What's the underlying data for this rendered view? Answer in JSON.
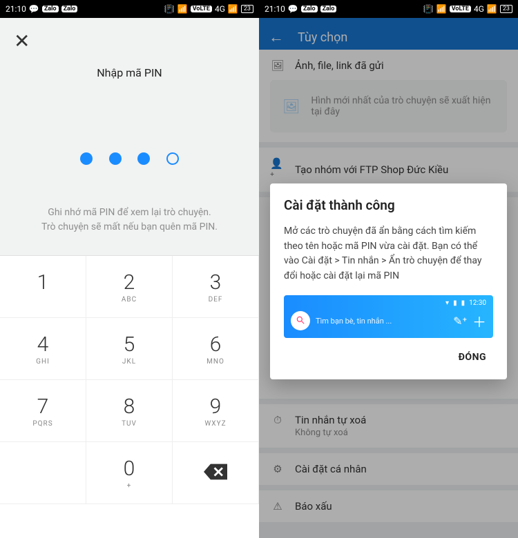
{
  "status": {
    "time": "21:10",
    "volte": "VoLTE",
    "lte": "4G",
    "battery": "23",
    "zalo": "Zalo"
  },
  "left": {
    "title": "Nhập mã PIN",
    "hint_line1": "Ghi nhớ mã PIN để xem lại trò chuyện.",
    "hint_line2": "Trò chuyện sẽ mất nếu bạn quên mã PIN.",
    "pin_entered": 3,
    "pin_total": 4,
    "keys": {
      "k1": "1",
      "k2": "2",
      "k3": "3",
      "k4": "4",
      "k5": "5",
      "k6": "6",
      "k7": "7",
      "k8": "8",
      "k9": "9",
      "k0": "0",
      "l2": "ABC",
      "l3": "DEF",
      "l4": "GHI",
      "l5": "JKL",
      "l6": "MNO",
      "l7": "PQRS",
      "l8": "TUV",
      "l9": "WXYZ",
      "l0": "+"
    }
  },
  "right": {
    "appbar_title": "Tùy chọn",
    "media_header": "Ảnh, file, link đã gửi",
    "media_placeholder": "Hình mới nhất của trò chuyện sẽ xuất hiện tại đây",
    "create_group": "Tạo nhóm với FTP Shop Đức Kiều",
    "auto_delete_label": "Tin nhắn tự xoá",
    "auto_delete_value": "Không tự xoá",
    "personal_settings": "Cài đặt cá nhân",
    "report": "Báo xấu",
    "dialog": {
      "title": "Cài đặt thành công",
      "body": "Mở các trò chuyện đã ẩn bằng cách tìm kiếm theo tên hoặc mã PIN vừa cài đặt. Bạn có thể vào Cài đặt > Tin nhắn > Ẩn trò chuyện để thay đổi hoặc cài đặt lại mã PIN",
      "preview_time": "12:30",
      "preview_placeholder": "Tìm bạn bè, tin nhắn ...",
      "close": "ĐÓNG"
    }
  }
}
